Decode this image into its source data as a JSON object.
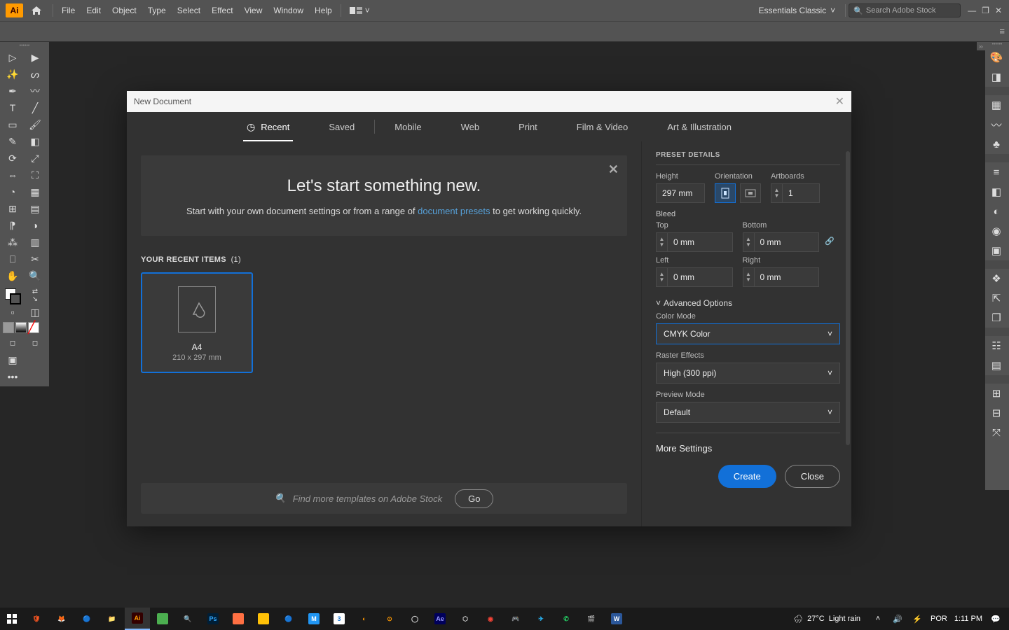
{
  "menubar": {
    "logo": "Ai",
    "items": [
      "File",
      "Edit",
      "Object",
      "Type",
      "Select",
      "Effect",
      "View",
      "Window",
      "Help"
    ],
    "workspace": "Essentials Classic",
    "search_placeholder": "Search Adobe Stock"
  },
  "dialog": {
    "title": "New Document",
    "tabs": {
      "recent": "Recent",
      "saved": "Saved",
      "mobile": "Mobile",
      "web": "Web",
      "print": "Print",
      "film": "Film & Video",
      "art": "Art & Illustration"
    },
    "hero": {
      "title": "Let's start something new.",
      "subtitle_a": "Start with your own document settings or from a range of ",
      "link": "document presets",
      "subtitle_b": " to get working quickly."
    },
    "recent_label": "YOUR RECENT ITEMS",
    "recent_count": "(1)",
    "item": {
      "name": "A4",
      "dim": "210 x 297 mm"
    },
    "search_placeholder": "Find more templates on Adobe Stock",
    "go": "Go",
    "details": {
      "header": "PRESET DETAILS",
      "height_label": "Height",
      "height_val": "297 mm",
      "orientation_label": "Orientation",
      "artboards_label": "Artboards",
      "artboards_val": "1",
      "bleed_label": "Bleed",
      "top": "Top",
      "bottom": "Bottom",
      "left": "Left",
      "right": "Right",
      "zero": "0 mm",
      "advanced": "Advanced Options",
      "color_mode_label": "Color Mode",
      "color_mode_val": "CMYK Color",
      "raster_label": "Raster Effects",
      "raster_val": "High (300 ppi)",
      "preview_label": "Preview Mode",
      "preview_val": "Default",
      "more": "More Settings",
      "create": "Create",
      "close": "Close"
    }
  },
  "taskbar": {
    "weather_temp": "27°C",
    "weather_cond": "Light rain",
    "lang": "POR",
    "time": "1:11 PM"
  }
}
